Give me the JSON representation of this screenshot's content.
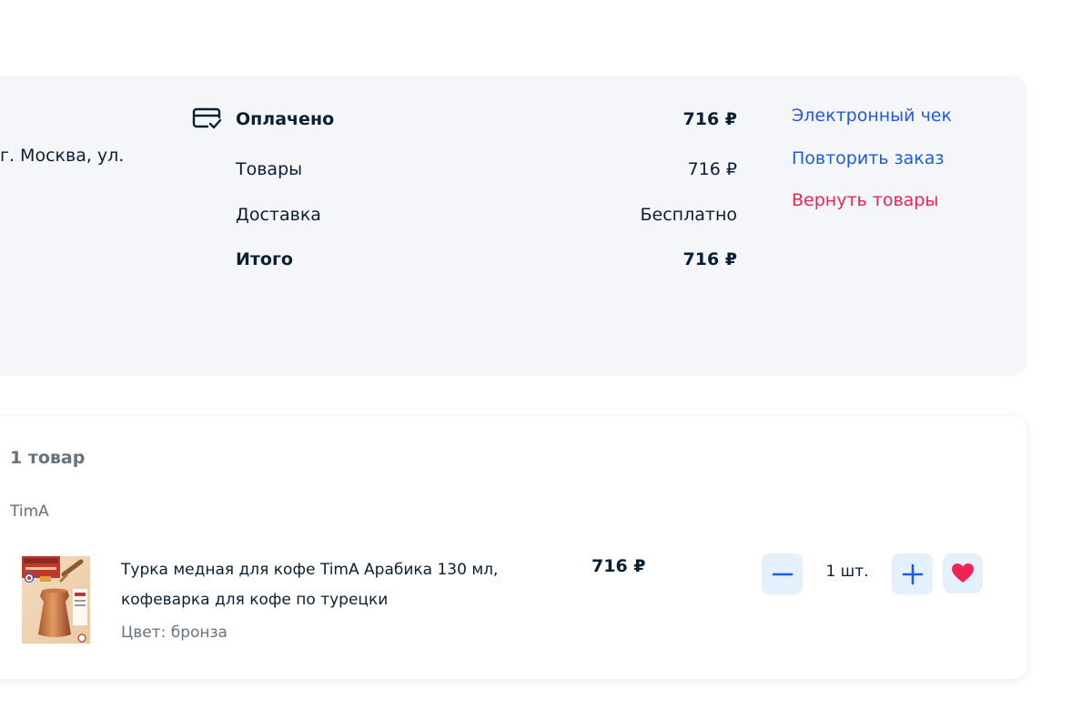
{
  "payment": {
    "address_fragment": "г. Москва, ул.",
    "status_label": "Оплачено",
    "status_amount": "716 ₽",
    "rows": [
      {
        "label": "Товары",
        "value": "716 ₽"
      },
      {
        "label": "Доставка",
        "value": "Бесплатно"
      },
      {
        "label": "Итого",
        "value": "716 ₽"
      }
    ],
    "links": {
      "receipt": "Электронный чек",
      "repeat": "Повторить заказ",
      "return": "Вернуть товары"
    }
  },
  "items": {
    "count_label": "1 товар",
    "seller": "TimA",
    "product": {
      "name": "Турка медная для кофе TimA Арабика 130 мл, кофеварка для кофе по турецки",
      "color": "Цвет: бронза",
      "price": "716 ₽",
      "quantity": "1 шт.",
      "image_label": "Турка медная"
    }
  },
  "icons": {
    "payment": "card-check-icon",
    "minus": "minus-icon",
    "plus": "plus-icon",
    "favorite": "heart-icon"
  },
  "colors": {
    "link_blue": "#1f5cd9",
    "link_red": "#ee2455",
    "text_primary": "#0b1f33",
    "text_secondary": "#66727f",
    "card_bg": "#f4f6f9",
    "button_bg": "#e4f0fb",
    "heart": "#ee2455"
  }
}
